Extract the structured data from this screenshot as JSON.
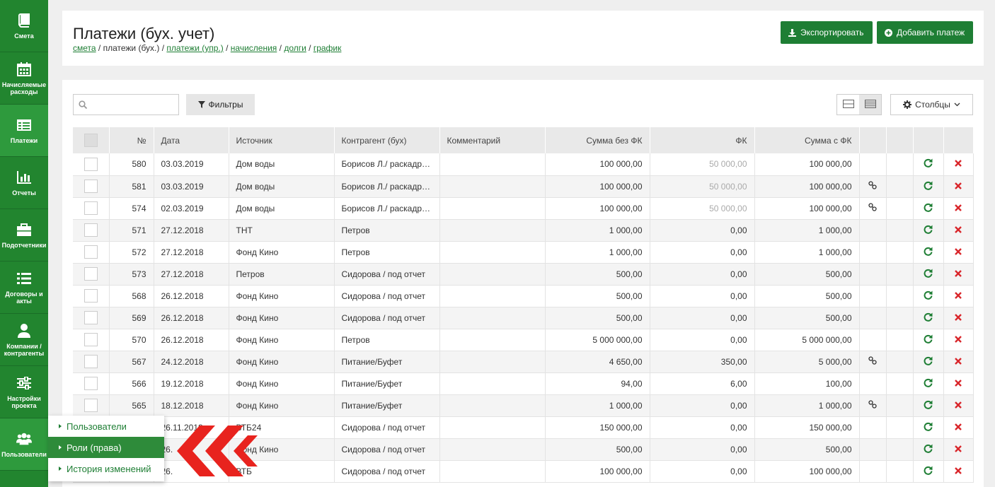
{
  "sidebar": {
    "items": [
      {
        "label": "Смета",
        "icon": "book-icon"
      },
      {
        "label": "Начисляемые расходы",
        "icon": "calendar-icon"
      },
      {
        "label": "Платежи",
        "icon": "list-icon"
      },
      {
        "label": "Отчеты",
        "icon": "chart-icon"
      },
      {
        "label": "Подотчетники",
        "icon": "briefcase-icon"
      },
      {
        "label": "Договоры и акты",
        "icon": "rows-icon"
      },
      {
        "label": "Компании / контрагенты",
        "icon": "user-icon"
      },
      {
        "label": "Настройки проекта",
        "icon": "sliders-icon"
      },
      {
        "label": "Пользователи",
        "icon": "users-icon"
      }
    ]
  },
  "header": {
    "title": "Платежи (бух. учет)",
    "breadcrumb": {
      "smeta": "смета",
      "sep": " / ",
      "current": "платежи (бух.)",
      "upr": "платежи (упр.)",
      "nach": "начисления",
      "dolgi": "долги",
      "grafik": "график"
    },
    "export_label": "Экспортировать",
    "add_label": "Добавить платеж"
  },
  "toolbar": {
    "search_placeholder": "",
    "filters_label": "Фильтры",
    "columns_label": "Столбцы"
  },
  "table": {
    "headers": [
      "№",
      "Дата",
      "Источник",
      "Контрагент (бух)",
      "Комментарий",
      "Сумма без ФК",
      "ФК",
      "Сумма с ФК"
    ],
    "rows": [
      {
        "num": "580",
        "date": "03.03.2019",
        "source": "Дом воды",
        "contractor": "Борисов Л./ раскадровка",
        "comment": "",
        "sum_no_fk": "100 000,00",
        "fk": "50 000,00",
        "fk_muted": true,
        "sum_fk": "100 000,00",
        "link": false
      },
      {
        "num": "581",
        "date": "03.03.2019",
        "source": "Дом воды",
        "contractor": "Борисов Л./ раскадровка",
        "comment": "",
        "sum_no_fk": "100 000,00",
        "fk": "50 000,00",
        "fk_muted": true,
        "sum_fk": "100 000,00",
        "link": true
      },
      {
        "num": "574",
        "date": "02.03.2019",
        "source": "Дом воды",
        "contractor": "Борисов Л./ раскадровка",
        "comment": "",
        "sum_no_fk": "100 000,00",
        "fk": "50 000,00",
        "fk_muted": true,
        "sum_fk": "100 000,00",
        "link": true
      },
      {
        "num": "571",
        "date": "27.12.2018",
        "source": "ТНТ",
        "contractor": "Петров",
        "comment": "",
        "sum_no_fk": "1 000,00",
        "fk": "0,00",
        "fk_muted": false,
        "sum_fk": "1 000,00",
        "link": false
      },
      {
        "num": "572",
        "date": "27.12.2018",
        "source": "Фонд Кино",
        "contractor": "Петров",
        "comment": "",
        "sum_no_fk": "1 000,00",
        "fk": "0,00",
        "fk_muted": false,
        "sum_fk": "1 000,00",
        "link": false
      },
      {
        "num": "573",
        "date": "27.12.2018",
        "source": "Петров",
        "contractor": "Сидорова / под отчет",
        "comment": "",
        "sum_no_fk": "500,00",
        "fk": "0,00",
        "fk_muted": false,
        "sum_fk": "500,00",
        "link": false
      },
      {
        "num": "568",
        "date": "26.12.2018",
        "source": "Фонд Кино",
        "contractor": "Сидорова / под отчет",
        "comment": "",
        "sum_no_fk": "500,00",
        "fk": "0,00",
        "fk_muted": false,
        "sum_fk": "500,00",
        "link": false
      },
      {
        "num": "569",
        "date": "26.12.2018",
        "source": "Фонд Кино",
        "contractor": "Сидорова / под отчет",
        "comment": "",
        "sum_no_fk": "500,00",
        "fk": "0,00",
        "fk_muted": false,
        "sum_fk": "500,00",
        "link": false
      },
      {
        "num": "570",
        "date": "26.12.2018",
        "source": "Фонд Кино",
        "contractor": "Петров",
        "comment": "",
        "sum_no_fk": "5 000 000,00",
        "fk": "0,00",
        "fk_muted": false,
        "sum_fk": "5 000 000,00",
        "link": false
      },
      {
        "num": "567",
        "date": "24.12.2018",
        "source": "Фонд Кино",
        "contractor": "Питание/Буфет",
        "comment": "",
        "sum_no_fk": "4 650,00",
        "fk": "350,00",
        "fk_muted": false,
        "sum_fk": "5 000,00",
        "link": true
      },
      {
        "num": "566",
        "date": "19.12.2018",
        "source": "Фонд Кино",
        "contractor": "Питание/Буфет",
        "comment": "",
        "sum_no_fk": "94,00",
        "fk": "6,00",
        "fk_muted": false,
        "sum_fk": "100,00",
        "link": false
      },
      {
        "num": "565",
        "date": "18.12.2018",
        "source": "Фонд Кино",
        "contractor": "Питание/Буфет",
        "comment": "",
        "sum_no_fk": "1 000,00",
        "fk": "0,00",
        "fk_muted": false,
        "sum_fk": "1 000,00",
        "link": true
      },
      {
        "num": "",
        "date": "26.11.2018",
        "source": "ВТБ24",
        "contractor": "Сидорова / под отчет",
        "comment": "",
        "sum_no_fk": "150 000,00",
        "fk": "0,00",
        "fk_muted": false,
        "sum_fk": "150 000,00",
        "link": false
      },
      {
        "num": "",
        "date": "26.",
        "source": "Фонд Кино",
        "contractor": "Сидорова / под отчет",
        "comment": "",
        "sum_no_fk": "500,00",
        "fk": "0,00",
        "fk_muted": false,
        "sum_fk": "500,00",
        "link": false
      },
      {
        "num": "",
        "date": "26.",
        "source": "ВТБ",
        "contractor": "Сидорова / под отчет",
        "comment": "",
        "sum_no_fk": "100 000,00",
        "fk": "0,00",
        "fk_muted": false,
        "sum_fk": "100 000,00",
        "link": false
      }
    ]
  },
  "submenu": {
    "items": [
      "Пользователи",
      "Роли (права)",
      "История изменений"
    ],
    "active_index": 1
  },
  "colors": {
    "brand": "#22852f",
    "brand_active": "#2e9a3d",
    "delete": "#d9262b",
    "arrow": "#e8231e"
  }
}
